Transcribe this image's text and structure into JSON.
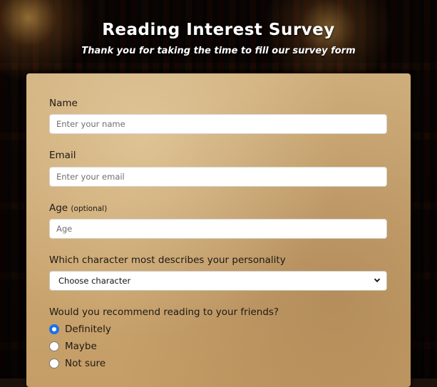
{
  "header": {
    "title": "Reading Interest Survey",
    "subtitle": "Thank you for taking the time to fill our survey form"
  },
  "form": {
    "name": {
      "label": "Name",
      "placeholder": "Enter your name",
      "value": ""
    },
    "email": {
      "label": "Email",
      "placeholder": "Enter your email",
      "value": ""
    },
    "age": {
      "label": "Age",
      "optional_note": "(optional)",
      "placeholder": "Age",
      "value": ""
    },
    "character": {
      "label": "Which character most describes your personality",
      "selected": "Choose character",
      "icon": "chevron-down-icon"
    },
    "recommend": {
      "question": "Would you recommend reading to your friends?",
      "options": [
        {
          "label": "Definitely",
          "checked": true
        },
        {
          "label": "Maybe",
          "checked": false
        },
        {
          "label": "Not sure",
          "checked": false
        }
      ]
    }
  },
  "colors": {
    "accent_radio": "#1a73e8",
    "card_parchment": "#c9a16b",
    "title_text": "#ffffff"
  }
}
